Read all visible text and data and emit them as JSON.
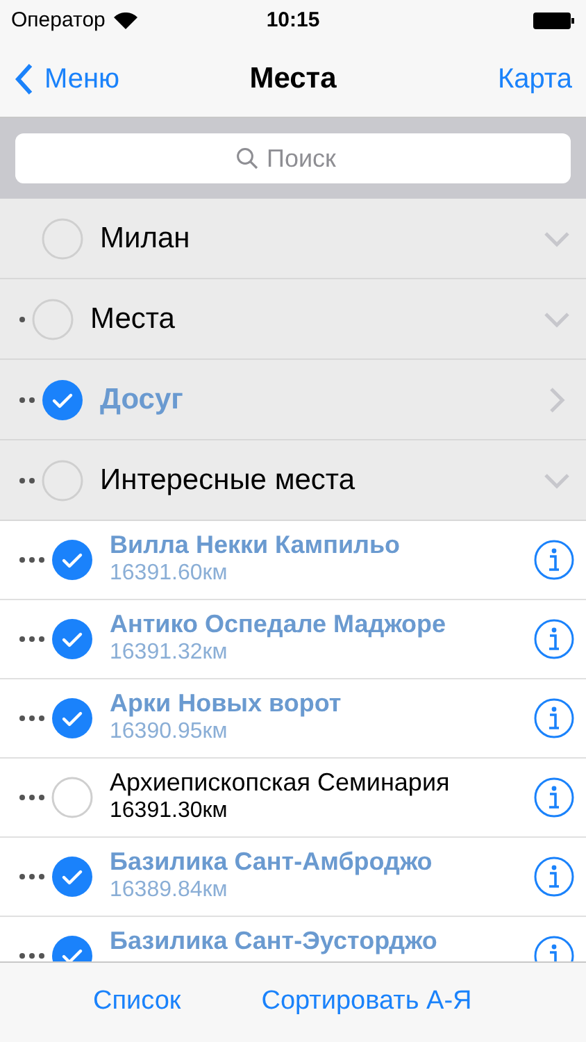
{
  "status_bar": {
    "carrier": "Оператор",
    "time": "10:15"
  },
  "nav": {
    "back": "Меню",
    "title": "Места",
    "action": "Карта"
  },
  "search": {
    "placeholder": "Поиск"
  },
  "tree": [
    {
      "kind": "group",
      "label": "Милан",
      "checked": false,
      "expanded": true,
      "children": [
        {
          "kind": "group",
          "label": "Места",
          "checked": false,
          "expanded": true,
          "children": [
            {
              "kind": "group",
              "label": "Досуг",
              "checked": true,
              "expanded": false
            },
            {
              "kind": "group",
              "label": "Интересные места",
              "checked": false,
              "expanded": true,
              "children": [
                {
                  "kind": "place",
                  "label": "Вилла Некки Кампильо",
                  "distance": "16391.60км",
                  "checked": true
                },
                {
                  "kind": "place",
                  "label": "Антико Оспедале Маджоре",
                  "distance": "16391.32км",
                  "checked": true
                },
                {
                  "kind": "place",
                  "label": "Арки Новых ворот",
                  "distance": "16390.95км",
                  "checked": true
                },
                {
                  "kind": "place",
                  "label": "Архиепископская Семинария",
                  "distance": "16391.30км",
                  "checked": false
                },
                {
                  "kind": "place",
                  "label": "Базилика Сант-Амброджо",
                  "distance": "16389.84км",
                  "checked": true
                },
                {
                  "kind": "place",
                  "label": "Базилика Сант-Эусторджо",
                  "checked": true
                }
              ]
            }
          ]
        }
      ]
    }
  ],
  "toolbar": [
    "Список",
    "Сортировать А-Я"
  ]
}
